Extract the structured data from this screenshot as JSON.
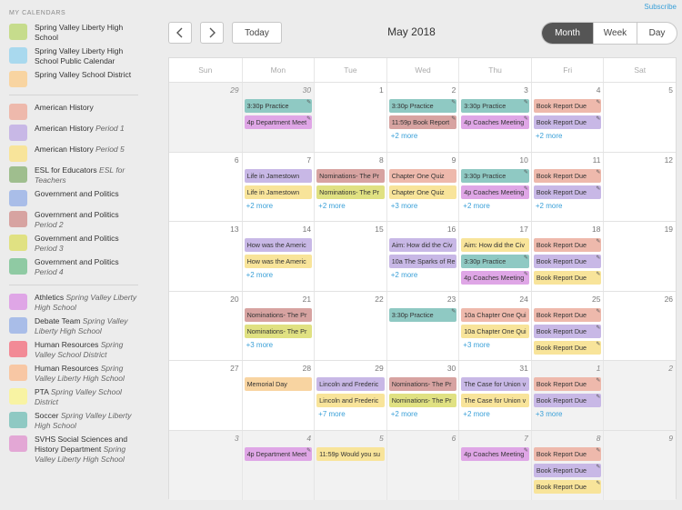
{
  "top": {
    "subscribe": "Subscribe",
    "today": "Today",
    "month_title": "May 2018",
    "views": [
      "Month",
      "Week",
      "Day"
    ],
    "active_view": "Month"
  },
  "colors": {
    "green": "#c6dc8c",
    "blue": "#a9d9ee",
    "orange": "#f8d4a1",
    "salmon": "#eeb9ac",
    "lavender": "#c8b8e6",
    "yellow": "#f8e49a",
    "sage": "#9fbe8e",
    "periwinkle": "#a9bde8",
    "rose": "#d7a3a1",
    "olive": "#e0e182",
    "sea": "#8fcaa3",
    "pink": "#dfa6e6",
    "red": "#f28a96",
    "peach": "#f8c7a4",
    "paleyellow": "#f8f3a3",
    "teal": "#8fc9c3",
    "mauve": "#e3a7d5"
  },
  "sidebar": {
    "header": "MY CALENDARS",
    "groups": [
      [
        {
          "name": "Spring Valley Liberty High School",
          "sub": "",
          "color": "#c6dc8c"
        },
        {
          "name": "Spring Valley Liberty High School Public Calendar",
          "sub": "",
          "color": "#a9d9ee"
        },
        {
          "name": "Spring Valley School District",
          "sub": "",
          "color": "#f8d4a1"
        }
      ],
      [
        {
          "name": "American History",
          "sub": "",
          "color": "#eeb9ac"
        },
        {
          "name": "American History",
          "sub": "Period 1",
          "color": "#c8b8e6"
        },
        {
          "name": "American History",
          "sub": "Period 5",
          "color": "#f8e49a"
        },
        {
          "name": "ESL for Educators",
          "sub": "ESL for Teachers",
          "color": "#9fbe8e"
        },
        {
          "name": "Government and Politics",
          "sub": "",
          "color": "#a9bde8"
        },
        {
          "name": "Government and Politics",
          "sub": "Period 2",
          "color": "#d7a3a1"
        },
        {
          "name": "Government and Politics",
          "sub": "Period 3",
          "color": "#e0e182"
        },
        {
          "name": "Government and Politics",
          "sub": "Period 4",
          "color": "#8fcaa3"
        }
      ],
      [
        {
          "name": "Athletics",
          "sub": "Spring Valley Liberty High School",
          "color": "#dfa6e6"
        },
        {
          "name": "Debate Team",
          "sub": "Spring Valley Liberty High School",
          "color": "#a9bde8"
        },
        {
          "name": "Human Resources",
          "sub": "Spring Valley School District",
          "color": "#f28a96"
        },
        {
          "name": "Human Resources",
          "sub": "Spring Valley Liberty High School",
          "color": "#f8c7a4"
        },
        {
          "name": "PTA",
          "sub": "Spring Valley School District",
          "color": "#f8f3a3"
        },
        {
          "name": "Soccer",
          "sub": "Spring Valley Liberty High School",
          "color": "#8fc9c3"
        },
        {
          "name": "SVHS Social Sciences and History Department",
          "sub": "Spring Valley Liberty High School",
          "color": "#e3a7d5"
        }
      ]
    ]
  },
  "calendar": {
    "days_of_week": [
      "Sun",
      "Mon",
      "Tue",
      "Wed",
      "Thu",
      "Fri",
      "Sat"
    ],
    "weeks": [
      [
        {
          "num": "29",
          "dim": true,
          "events": [],
          "more": ""
        },
        {
          "num": "30",
          "dim": true,
          "events": [
            {
              "text": "3:30p Practice",
              "color": "#8fc9c3",
              "mark": true
            },
            {
              "text": "4p Department Meet",
              "color": "#dfa6e6",
              "mark": true
            }
          ],
          "more": ""
        },
        {
          "num": "1",
          "dim": false,
          "events": [],
          "more": ""
        },
        {
          "num": "2",
          "dim": false,
          "events": [
            {
              "text": "3:30p Practice",
              "color": "#8fc9c3",
              "mark": true
            },
            {
              "text": "11:59p Book Report",
              "color": "#d7a3a1",
              "mark": true
            }
          ],
          "more": "+2 more"
        },
        {
          "num": "3",
          "dim": false,
          "events": [
            {
              "text": "3:30p Practice",
              "color": "#8fc9c3",
              "mark": true
            },
            {
              "text": "4p Coaches Meeting",
              "color": "#dfa6e6",
              "mark": true
            }
          ],
          "more": ""
        },
        {
          "num": "4",
          "dim": false,
          "events": [
            {
              "text": "Book Report Due",
              "color": "#eeb9ac",
              "mark": true
            },
            {
              "text": "Book Report Due",
              "color": "#c8b8e6",
              "mark": true
            }
          ],
          "more": "+2 more"
        },
        {
          "num": "5",
          "dim": false,
          "events": [],
          "more": ""
        }
      ],
      [
        {
          "num": "6",
          "dim": false,
          "events": [],
          "more": ""
        },
        {
          "num": "7",
          "dim": false,
          "events": [
            {
              "text": "Life in Jamestown",
              "color": "#c8b8e6",
              "mark": false
            },
            {
              "text": "Life in Jamestown",
              "color": "#f8e49a",
              "mark": false
            }
          ],
          "more": "+2 more"
        },
        {
          "num": "8",
          "dim": false,
          "events": [
            {
              "text": "Nominations- The Pr",
              "color": "#d7a3a1",
              "mark": false
            },
            {
              "text": "Nominations- The Pr",
              "color": "#e0e182",
              "mark": false
            }
          ],
          "more": "+2 more"
        },
        {
          "num": "9",
          "dim": false,
          "events": [
            {
              "text": "Chapter One Quiz",
              "color": "#eeb9ac",
              "mark": false
            },
            {
              "text": "Chapter One Quiz",
              "color": "#f8e49a",
              "mark": false
            }
          ],
          "more": "+3 more"
        },
        {
          "num": "10",
          "dim": false,
          "events": [
            {
              "text": "3:30p Practice",
              "color": "#8fc9c3",
              "mark": true
            },
            {
              "text": "4p Coaches Meeting",
              "color": "#dfa6e6",
              "mark": true
            }
          ],
          "more": "+2 more"
        },
        {
          "num": "11",
          "dim": false,
          "events": [
            {
              "text": "Book Report Due",
              "color": "#eeb9ac",
              "mark": true
            },
            {
              "text": "Book Report Due",
              "color": "#c8b8e6",
              "mark": true
            }
          ],
          "more": "+2 more"
        },
        {
          "num": "12",
          "dim": false,
          "events": [],
          "more": ""
        }
      ],
      [
        {
          "num": "13",
          "dim": false,
          "events": [],
          "more": ""
        },
        {
          "num": "14",
          "dim": false,
          "events": [
            {
              "text": "How was the Americ",
              "color": "#c8b8e6",
              "mark": false
            },
            {
              "text": "How was the Americ",
              "color": "#f8e49a",
              "mark": false
            }
          ],
          "more": "+2 more"
        },
        {
          "num": "15",
          "dim": false,
          "events": [],
          "more": ""
        },
        {
          "num": "16",
          "dim": false,
          "events": [
            {
              "text": "Aim: How did the Civ",
              "color": "#c8b8e6",
              "mark": false
            },
            {
              "text": "10a The Sparks of Re",
              "color": "#c8b8e6",
              "mark": false
            }
          ],
          "more": "+2 more"
        },
        {
          "num": "17",
          "dim": false,
          "events": [
            {
              "text": "Aim: How did the Civ",
              "color": "#f8e49a",
              "mark": false
            },
            {
              "text": "3:30p Practice",
              "color": "#8fc9c3",
              "mark": true
            },
            {
              "text": "4p Coaches Meeting",
              "color": "#dfa6e6",
              "mark": true
            }
          ],
          "more": ""
        },
        {
          "num": "18",
          "dim": false,
          "events": [
            {
              "text": "Book Report Due",
              "color": "#eeb9ac",
              "mark": true
            },
            {
              "text": "Book Report Due",
              "color": "#c8b8e6",
              "mark": true
            },
            {
              "text": "Book Report Due",
              "color": "#f8e49a",
              "mark": true
            }
          ],
          "more": ""
        },
        {
          "num": "19",
          "dim": false,
          "events": [],
          "more": ""
        }
      ],
      [
        {
          "num": "20",
          "dim": false,
          "events": [],
          "more": ""
        },
        {
          "num": "21",
          "dim": false,
          "events": [
            {
              "text": "Nominations- The Pr",
              "color": "#d7a3a1",
              "mark": false
            },
            {
              "text": "Nominations- The Pr",
              "color": "#e0e182",
              "mark": false
            }
          ],
          "more": "+3 more"
        },
        {
          "num": "22",
          "dim": false,
          "events": [],
          "more": ""
        },
        {
          "num": "23",
          "dim": false,
          "events": [
            {
              "text": "3:30p Practice",
              "color": "#8fc9c3",
              "mark": true
            }
          ],
          "more": ""
        },
        {
          "num": "24",
          "dim": false,
          "events": [
            {
              "text": "10a Chapter One Qui",
              "color": "#eeb9ac",
              "mark": false
            },
            {
              "text": "10a Chapter One Qui",
              "color": "#f8e49a",
              "mark": false
            }
          ],
          "more": "+3 more"
        },
        {
          "num": "25",
          "dim": false,
          "events": [
            {
              "text": "Book Report Due",
              "color": "#eeb9ac",
              "mark": true
            },
            {
              "text": "Book Report Due",
              "color": "#c8b8e6",
              "mark": true
            },
            {
              "text": "Book Report Due",
              "color": "#f8e49a",
              "mark": true
            }
          ],
          "more": ""
        },
        {
          "num": "26",
          "dim": false,
          "events": [],
          "more": ""
        }
      ],
      [
        {
          "num": "27",
          "dim": false,
          "events": [],
          "more": ""
        },
        {
          "num": "28",
          "dim": false,
          "events": [
            {
              "text": "Memorial Day",
              "color": "#f8d4a1",
              "mark": false
            }
          ],
          "more": ""
        },
        {
          "num": "29",
          "dim": false,
          "events": [
            {
              "text": "Lincoln and Frederic",
              "color": "#c8b8e6",
              "mark": false
            },
            {
              "text": "Lincoln and Frederic",
              "color": "#f8e49a",
              "mark": false
            }
          ],
          "more": "+7 more"
        },
        {
          "num": "30",
          "dim": false,
          "events": [
            {
              "text": "Nominations- The Pr",
              "color": "#d7a3a1",
              "mark": false
            },
            {
              "text": "Nominations- The Pr",
              "color": "#e0e182",
              "mark": false
            }
          ],
          "more": "+2 more"
        },
        {
          "num": "31",
          "dim": false,
          "events": [
            {
              "text": "The Case for Union v",
              "color": "#c8b8e6",
              "mark": false
            },
            {
              "text": "The Case for Union v",
              "color": "#f8e49a",
              "mark": false
            }
          ],
          "more": "+2 more"
        },
        {
          "num": "1",
          "dim": true,
          "events": [
            {
              "text": "Book Report Due",
              "color": "#eeb9ac",
              "mark": true
            },
            {
              "text": "Book Report Due",
              "color": "#c8b8e6",
              "mark": true
            }
          ],
          "more": "+3 more"
        },
        {
          "num": "2",
          "dim": true,
          "events": [],
          "more": ""
        }
      ],
      [
        {
          "num": "3",
          "dim": true,
          "events": [],
          "more": ""
        },
        {
          "num": "4",
          "dim": true,
          "events": [
            {
              "text": "4p Department Meet",
              "color": "#dfa6e6",
              "mark": true
            }
          ],
          "more": ""
        },
        {
          "num": "5",
          "dim": true,
          "events": [
            {
              "text": "11:59p Would you su",
              "color": "#f8e49a",
              "mark": false
            }
          ],
          "more": ""
        },
        {
          "num": "6",
          "dim": true,
          "events": [],
          "more": ""
        },
        {
          "num": "7",
          "dim": true,
          "events": [
            {
              "text": "4p Coaches Meeting",
              "color": "#dfa6e6",
              "mark": true
            }
          ],
          "more": ""
        },
        {
          "num": "8",
          "dim": true,
          "events": [
            {
              "text": "Book Report Due",
              "color": "#eeb9ac",
              "mark": true
            },
            {
              "text": "Book Report Due",
              "color": "#c8b8e6",
              "mark": true
            },
            {
              "text": "Book Report Due",
              "color": "#f8e49a",
              "mark": true
            }
          ],
          "more": ""
        },
        {
          "num": "9",
          "dim": true,
          "events": [],
          "more": ""
        }
      ]
    ]
  }
}
